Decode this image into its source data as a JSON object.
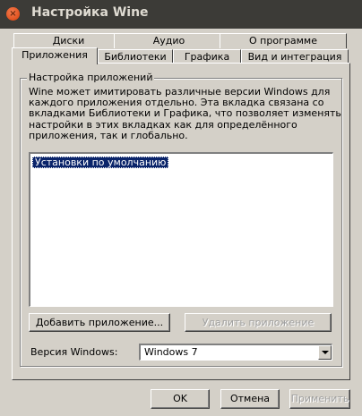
{
  "window": {
    "title": "Настройка Wine",
    "close_glyph": "×"
  },
  "tabs_top": [
    "Диски",
    "Аудио",
    "О программе"
  ],
  "tabs_bottom": [
    "Приложения",
    "Библиотеки",
    "Графика",
    "Вид и интеграция"
  ],
  "active_tab": "Приложения",
  "group": {
    "title": "Настройка приложений",
    "description_lines": [
      "Wine может имитировать различные версии Windows для",
      "каждого приложения отдельно. Эта вкладка связана со",
      "вкладками Библиотеки и Графика, что позволяет изменять",
      "настройки в этих вкладках как для определённого",
      "приложения, так и глобально."
    ],
    "list_items": [
      "Установки по умолчанию"
    ],
    "add_button": "Добавить приложение...",
    "remove_button": "Удалить приложение",
    "version_label": "Версия Windows:",
    "version_value": "Windows 7"
  },
  "footer": {
    "ok": "OK",
    "cancel": "Отмена",
    "apply": "Применить"
  },
  "colors": {
    "titlebar": "#3c3b37",
    "close_button": "#e0521f",
    "window_bg": "#d4d0c8",
    "selection": "#0a246a"
  },
  "icons": {
    "close": "close-icon",
    "dropdown": "chevron-down-icon"
  }
}
